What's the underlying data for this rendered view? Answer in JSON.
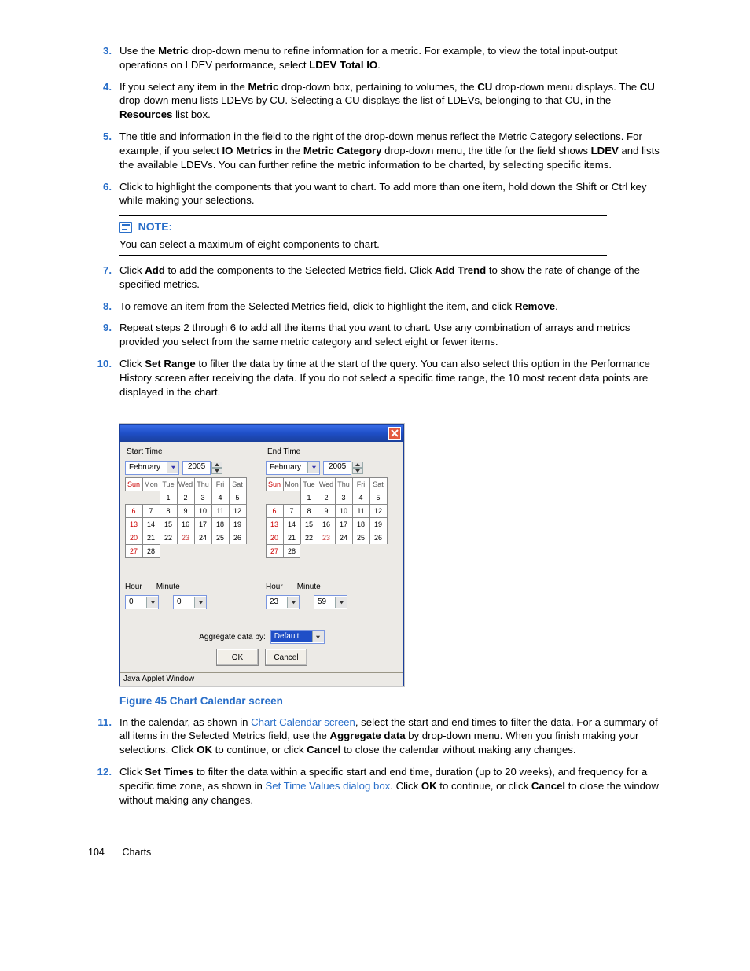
{
  "steps": {
    "s3": {
      "n": "3."
    },
    "s4": {
      "n": "4."
    },
    "s5": {
      "n": "5."
    },
    "s6": {
      "n": "6."
    },
    "s7": {
      "n": "7."
    },
    "s8": {
      "n": "8."
    },
    "s9": {
      "n": "9."
    },
    "s10": {
      "n": "10."
    },
    "s11": {
      "n": "11."
    },
    "s12": {
      "n": "12."
    }
  },
  "t": {
    "s3a": "Use the ",
    "s3b": "Metric",
    "s3c": " drop-down menu to refine information for a metric. For example, to view the total input-output operations on LDEV performance, select ",
    "s3d": "LDEV Total IO",
    "s3e": ".",
    "s4a": "If you select any item in the ",
    "s4b": "Metric",
    "s4c": " drop-down box, pertaining to volumes, the ",
    "s4d": "CU",
    "s4e": " drop-down menu displays. The ",
    "s4f": "CU",
    "s4g": " drop-down menu lists LDEVs by CU. Selecting a CU displays the list of LDEVs, belonging to that CU, in the ",
    "s4h": "Resources",
    "s4i": " list box.",
    "s5a": "The title and information in the field to the right of the drop-down menus reflect the Metric Category selections. For example, if you select ",
    "s5b": "IO Metrics",
    "s5c": " in the ",
    "s5d": "Metric Category",
    "s5e": " drop-down menu, the title for the field shows ",
    "s5f": "LDEV",
    "s5g": " and lists the available LDEVs. You can further refine the metric information to be charted, by selecting specific items.",
    "s6": "Click to highlight the components that you want to chart. To add more than one item, hold down the Shift or Ctrl key while making your selections.",
    "s7a": "Click ",
    "s7b": "Add",
    "s7c": " to add the components to the Selected Metrics field. Click ",
    "s7d": "Add Trend",
    "s7e": " to show the rate of change of the specified metrics.",
    "s8a": "To remove an item from the Selected Metrics field, click to highlight the item, and click ",
    "s8b": "Remove",
    "s8c": ".",
    "s9": "Repeat steps 2 through 6 to add all the items that you want to chart. Use any combination of arrays and metrics provided you select from the same metric category and select eight or fewer items.",
    "s10a": "Click ",
    "s10b": "Set Range",
    "s10c": " to filter the data by time at the start of the query. You can also select this option in the Performance History screen after receiving the data. If you do not select a specific time range, the 10 most recent data points are displayed in the chart.",
    "s11a": "In the calendar, as shown in ",
    "s11b": "Chart Calendar screen",
    "s11c": ", select the start and end times to filter the data. For a summary of all items in the Selected Metrics field, use the ",
    "s11d": "Aggregate data",
    "s11e": " by drop-down menu. When you finish making your selections. Click ",
    "s11f": "OK",
    "s11g": " to continue, or click ",
    "s11h": "Cancel",
    "s11i": " to close the calendar without making any changes.",
    "s12a": "Click ",
    "s12b": "Set Times",
    "s12c": " to filter the data within a specific start and end time, duration (up to 20 weeks), and frequency for a specific time zone, as shown in ",
    "s12d": "Set Time Values dialog box",
    "s12e": ". Click ",
    "s12f": "OK",
    "s12g": " to continue, or click ",
    "s12h": "Cancel",
    "s12i": " to close the window without making any changes."
  },
  "note": {
    "title": "NOTE:",
    "body": "You can select a maximum of eight components to chart."
  },
  "caption": "Figure 45 Chart Calendar screen",
  "footer": {
    "page": "104",
    "section": "Charts"
  },
  "dialog": {
    "start_label": "Start Time",
    "end_label": "End Time",
    "month": "February",
    "year": "2005",
    "headers": [
      "Sun",
      "Mon",
      "Tue",
      "Wed",
      "Thu",
      "Fri",
      "Sat"
    ],
    "row1": [
      "",
      "",
      "1",
      "2",
      "3",
      "4",
      "5"
    ],
    "row2": [
      "6",
      "7",
      "8",
      "9",
      "10",
      "11",
      "12"
    ],
    "row3": [
      "13",
      "14",
      "15",
      "16",
      "17",
      "18",
      "19"
    ],
    "row4": [
      "20",
      "21",
      "22",
      "23",
      "24",
      "25",
      "26"
    ],
    "row5": [
      "27",
      "28",
      "",
      "",
      "",
      "",
      ""
    ],
    "current": "23",
    "hour_label": "Hour",
    "minute_label": "Minute",
    "start_hour": "0",
    "start_minute": "0",
    "end_hour": "23",
    "end_minute": "59",
    "agg_label": "Aggregate data by:",
    "agg_value": "Default",
    "ok": "OK",
    "cancel": "Cancel",
    "status": "Java Applet Window"
  }
}
